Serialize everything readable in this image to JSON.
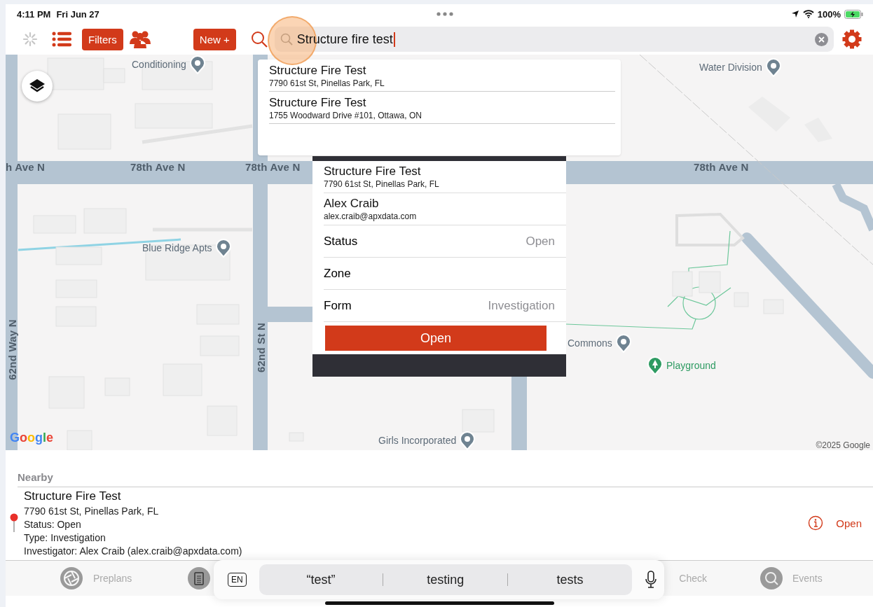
{
  "status_bar": {
    "time": "4:11 PM",
    "date": "Fri Jun 27",
    "battery": "100%"
  },
  "toolbar": {
    "filters": "Filters",
    "new": "New +",
    "search_value": "Structure fire test"
  },
  "search_results": [
    {
      "title": "Structure Fire Test",
      "address": "7790 61st St, Pinellas Park, FL"
    },
    {
      "title": "Structure Fire Test",
      "address": "1755 Woodward Drive #101, Ottawa, ON"
    }
  ],
  "map": {
    "labels": [
      {
        "text": "Conditioning",
        "kind": "place"
      },
      {
        "text": "Water Division",
        "kind": "place"
      },
      {
        "text": "h Ave N",
        "kind": "road"
      },
      {
        "text": "78th Ave N",
        "kind": "road"
      },
      {
        "text": "78th Ave N",
        "kind": "road"
      },
      {
        "text": "78th Ave N",
        "kind": "road"
      },
      {
        "text": "62nd Way N",
        "kind": "road-vertical"
      },
      {
        "text": "62nd St N",
        "kind": "road-vertical"
      },
      {
        "text": "Blue Ridge Apts",
        "kind": "place"
      },
      {
        "text": "Commons",
        "kind": "place"
      },
      {
        "text": "Playground",
        "kind": "park"
      },
      {
        "text": "Google",
        "kind": "logo"
      },
      {
        "text": "Girls Incorporated",
        "kind": "place"
      },
      {
        "text": "©2025 Google",
        "kind": "attribution"
      }
    ]
  },
  "popup": {
    "title": "Structure Fire Test",
    "address": "7790 61st St, Pinellas Park, FL",
    "person": "Alex Craib",
    "email": "alex.craib@apxdata.com",
    "rows": [
      {
        "label": "Status",
        "value": "Open"
      },
      {
        "label": "Zone"
      },
      {
        "label": "Form",
        "value": "Investigation"
      }
    ],
    "button": "Open"
  },
  "nearby": {
    "heading": "Nearby",
    "item": {
      "title": "Structure Fire Test",
      "lines": [
        "7790 61st St, Pinellas Park, FL",
        "Status: Open",
        "Type: Investigation",
        "Investigator: Alex Craib (alex.craib@apxdata.com)"
      ],
      "action": "Open"
    }
  },
  "tabs": [
    {
      "label": "Preplans",
      "kind": "aperture"
    },
    {
      "kind": "clipboard"
    },
    {
      "label": "Check",
      "kind": "plain"
    },
    {
      "label": "Events",
      "kind": "magnifier"
    }
  ],
  "keyboard": {
    "language": "EN",
    "suggestions": [
      "“test”",
      "testing",
      "tests"
    ]
  }
}
